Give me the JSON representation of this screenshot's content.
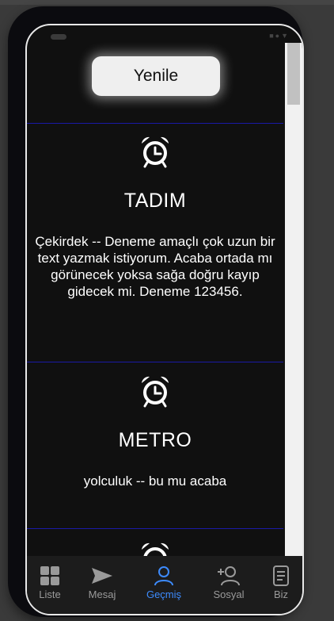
{
  "refresh": {
    "label": "Yenile"
  },
  "cards": [
    {
      "title": "TADIM",
      "description": "Çekirdek -- Deneme amaçlı çok uzun bir text yazmak istiyorum. Acaba ortada mı görünecek yoksa sağa doğru kayıp gidecek mi. Deneme 123456."
    },
    {
      "title": "METRO",
      "description": "yolculuk -- bu mu acaba"
    }
  ],
  "tabs": [
    {
      "label": "Liste",
      "icon": "grid-icon"
    },
    {
      "label": "Mesaj",
      "icon": "send-icon"
    },
    {
      "label": "Geçmiş",
      "icon": "user-icon",
      "active": true
    },
    {
      "label": "Sosyal",
      "icon": "add-user-icon"
    },
    {
      "label": "Biz",
      "icon": "document-icon"
    }
  ],
  "colors": {
    "active_tab": "#3d8bfd",
    "divider": "#1a1aa6",
    "background": "#101010"
  }
}
